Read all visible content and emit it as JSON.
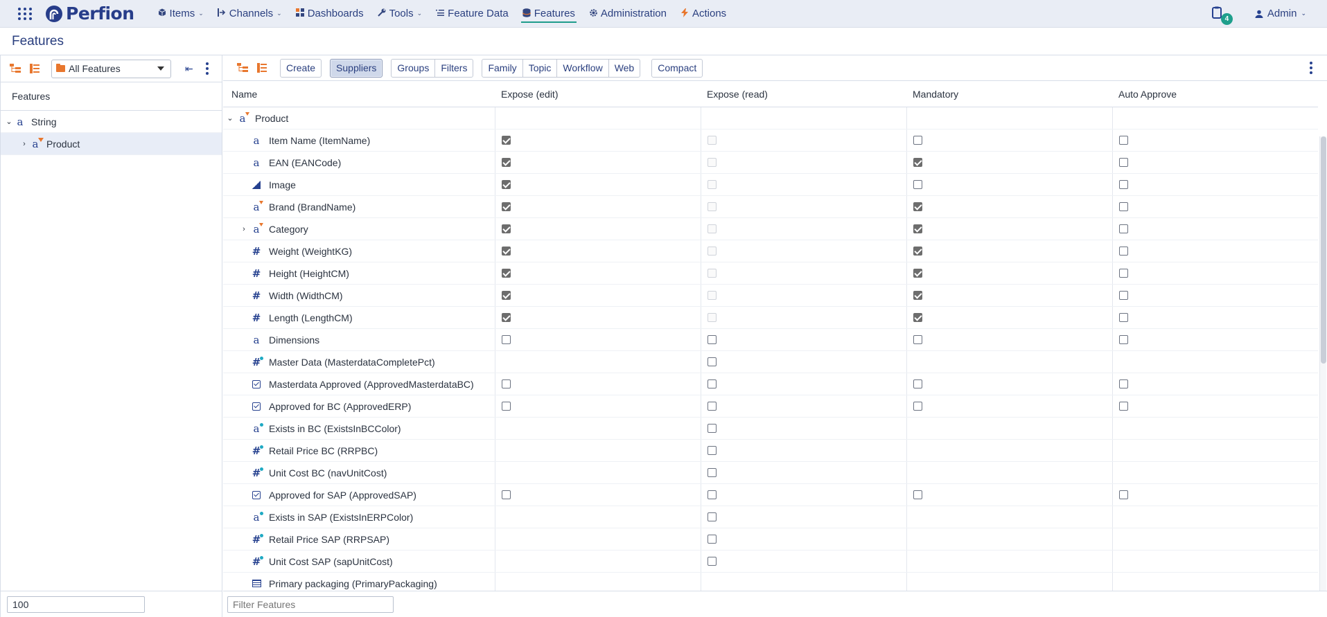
{
  "nav": {
    "logo": "Perfion",
    "items": [
      {
        "label": "Items",
        "icon": "cube-icon",
        "caret": true
      },
      {
        "label": "Channels",
        "icon": "channels-icon",
        "caret": true
      },
      {
        "label": "Dashboards",
        "icon": "dashboard-icon",
        "caret": false
      },
      {
        "label": "Tools",
        "icon": "wrench-icon",
        "caret": true
      },
      {
        "label": "Feature Data",
        "icon": "list-icon",
        "caret": false
      },
      {
        "label": "Features",
        "icon": "database-icon",
        "caret": false,
        "active": true
      },
      {
        "label": "Administration",
        "icon": "gear-icon",
        "caret": false
      },
      {
        "label": "Actions",
        "icon": "lightning-icon",
        "caret": false
      }
    ],
    "notifications": "4",
    "user": "Admin"
  },
  "page": {
    "title": "Features"
  },
  "left": {
    "selector": "All Features",
    "header": "Features",
    "tree": [
      {
        "label": "String",
        "expanded": true,
        "level": 0
      },
      {
        "label": "Product",
        "expanded": false,
        "level": 1,
        "selected": true
      }
    ],
    "footer_value": "100"
  },
  "toolbar": {
    "buttons": {
      "create": "Create",
      "suppliers": "Suppliers",
      "groups": "Groups",
      "filters": "Filters",
      "family": "Family",
      "topic": "Topic",
      "workflow": "Workflow",
      "web": "Web",
      "compact": "Compact"
    }
  },
  "grid": {
    "columns": [
      "Name",
      "Expose (edit)",
      "Expose (read)",
      "Mandatory",
      "Auto Approve"
    ],
    "rows": [
      {
        "name": "Product",
        "type": "a-tri",
        "group": true,
        "cells": [
          "",
          "",
          "",
          ""
        ]
      },
      {
        "name": "Item Name (ItemName)",
        "type": "a",
        "cells": [
          "checked",
          "disabled",
          "unchecked",
          "unchecked"
        ]
      },
      {
        "name": "EAN (EANCode)",
        "type": "a",
        "cells": [
          "checked",
          "disabled",
          "checked",
          "unchecked"
        ]
      },
      {
        "name": "Image",
        "type": "img",
        "cells": [
          "checked",
          "disabled",
          "unchecked",
          "unchecked"
        ]
      },
      {
        "name": "Brand (BrandName)",
        "type": "a-tri",
        "cells": [
          "checked",
          "disabled",
          "checked",
          "unchecked"
        ]
      },
      {
        "name": "Category",
        "type": "a-tri",
        "expandable": true,
        "cells": [
          "checked",
          "disabled",
          "checked",
          "unchecked"
        ]
      },
      {
        "name": "Weight (WeightKG)",
        "type": "hash",
        "cells": [
          "checked",
          "disabled",
          "checked",
          "unchecked"
        ]
      },
      {
        "name": "Height (HeightCM)",
        "type": "hash",
        "cells": [
          "checked",
          "disabled",
          "checked",
          "unchecked"
        ]
      },
      {
        "name": "Width (WidthCM)",
        "type": "hash",
        "cells": [
          "checked",
          "disabled",
          "checked",
          "unchecked"
        ]
      },
      {
        "name": "Length (LengthCM)",
        "type": "hash",
        "cells": [
          "checked",
          "disabled",
          "checked",
          "unchecked"
        ]
      },
      {
        "name": "Dimensions",
        "type": "a",
        "cells": [
          "unchecked",
          "unchecked",
          "unchecked",
          "unchecked"
        ]
      },
      {
        "name": "Master Data (MasterdataCompletePct)",
        "type": "hash-dot",
        "cells": [
          "",
          "unchecked",
          "",
          ""
        ]
      },
      {
        "name": "Masterdata Approved (ApprovedMasterdataBC)",
        "type": "chk",
        "cells": [
          "unchecked",
          "unchecked",
          "unchecked",
          "unchecked"
        ]
      },
      {
        "name": "Approved for BC (ApprovedERP)",
        "type": "chk",
        "cells": [
          "unchecked",
          "unchecked",
          "unchecked",
          "unchecked"
        ]
      },
      {
        "name": "Exists in BC (ExistsInBCColor)",
        "type": "a-dot",
        "cells": [
          "",
          "unchecked",
          "",
          ""
        ]
      },
      {
        "name": "Retail Price BC (RRPBC)",
        "type": "hash-dot",
        "cells": [
          "",
          "unchecked",
          "",
          ""
        ]
      },
      {
        "name": "Unit Cost BC (navUnitCost)",
        "type": "hash-dot",
        "cells": [
          "",
          "unchecked",
          "",
          ""
        ]
      },
      {
        "name": "Approved for SAP (ApprovedSAP)",
        "type": "chk",
        "cells": [
          "unchecked",
          "unchecked",
          "unchecked",
          "unchecked"
        ]
      },
      {
        "name": "Exists in SAP (ExistsInERPColor)",
        "type": "a-dot",
        "cells": [
          "",
          "unchecked",
          "",
          ""
        ]
      },
      {
        "name": "Retail Price SAP (RRPSAP)",
        "type": "hash-dot",
        "cells": [
          "",
          "unchecked",
          "",
          ""
        ]
      },
      {
        "name": "Unit Cost SAP (sapUnitCost)",
        "type": "hash-dot",
        "cells": [
          "",
          "unchecked",
          "",
          ""
        ]
      },
      {
        "name": "Primary packaging (PrimaryPackaging)",
        "type": "tbl",
        "cells": [
          "",
          "",
          "",
          ""
        ]
      }
    ]
  },
  "filter": {
    "placeholder": "Filter Features"
  },
  "colors": {
    "accent": "#1d9c8b",
    "brand": "#273d8a",
    "orange": "#e8772e"
  }
}
